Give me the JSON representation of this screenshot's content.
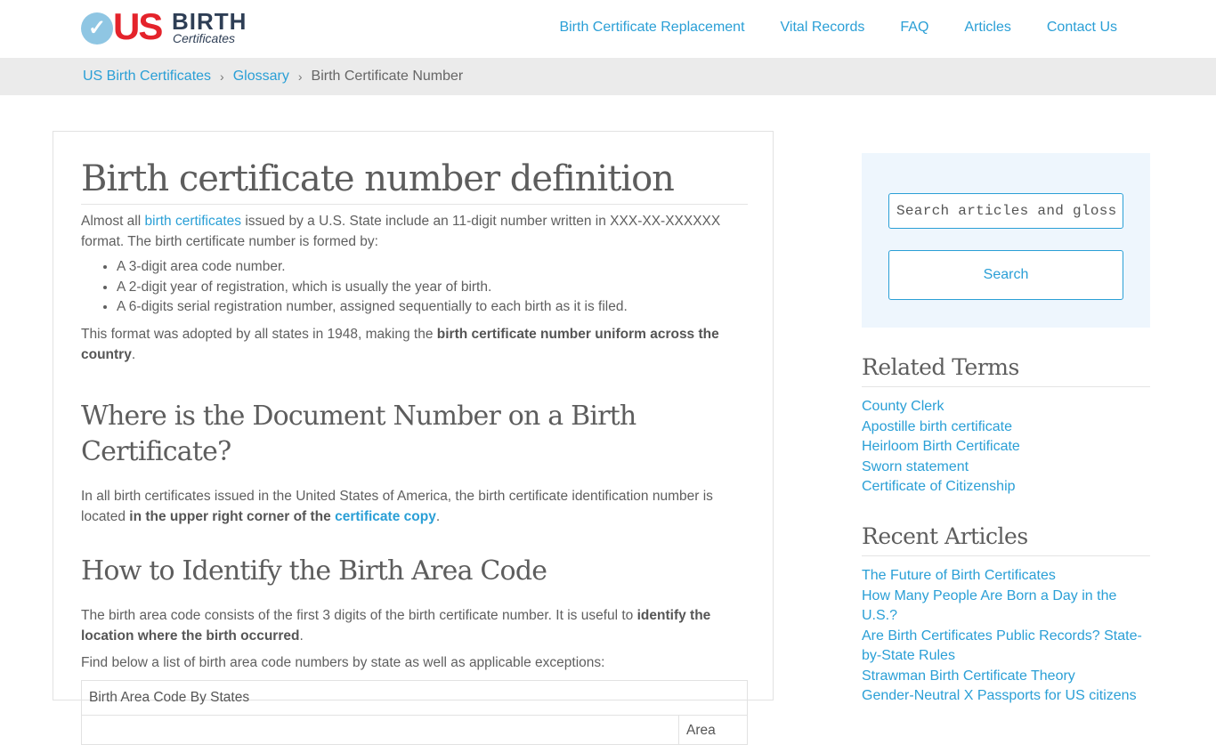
{
  "header": {
    "logo": {
      "us": "US",
      "birth": "BIRTH",
      "certificates": "Certificates"
    },
    "nav": [
      "Birth Certificate Replacement",
      "Vital Records",
      "FAQ",
      "Articles",
      "Contact Us"
    ]
  },
  "breadcrumb": {
    "items": [
      "US Birth Certificates",
      "Glossary"
    ],
    "separator": "›",
    "current": "Birth Certificate Number"
  },
  "article": {
    "title": "Birth certificate number definition",
    "intro": {
      "before": "Almost all ",
      "link": "birth certificates",
      "after": " issued by a U.S. State include an 11-digit number written in XXX-XX-XXXXXX format. The birth certificate number is formed by:"
    },
    "bullets": [
      "A 3-digit area code number.",
      "A 2-digit year of registration, which is usually the year of birth.",
      "A 6-digits serial registration number, assigned sequentially to each birth as it is filed."
    ],
    "adopted": {
      "before": "This format was adopted by all states in 1948, making the ",
      "bold": "birth certificate number uniform across the country",
      "after": "."
    },
    "h2_location": "Where is the Document Number on a Birth Certificate?",
    "location": {
      "before": "In all birth certificates issued in the United States of America, the birth certificate identification number is located ",
      "bold": "in the upper right corner of the ",
      "link": "certificate copy",
      "after": "."
    },
    "h2_area": "How to Identify the Birth Area Code",
    "area": {
      "before": "The birth area code consists of the first 3 digits of the birth certificate number. It is useful to ",
      "bold": "identify the location where the birth occurred",
      "after": "."
    },
    "find_below": "Find below a list of birth area code numbers by state as well as applicable exceptions:",
    "table": {
      "caption": "Birth Area Code By States",
      "col_area": "Area"
    }
  },
  "sidebar": {
    "search": {
      "placeholder": "Search articles and glossary",
      "button": "Search"
    },
    "related_heading": "Related Terms",
    "related": [
      "County Clerk",
      "Apostille birth certificate",
      "Heirloom Birth Certificate",
      "Sworn statement",
      "Certificate of Citizenship"
    ],
    "recent_heading": "Recent Articles",
    "recent": [
      "The Future of Birth Certificates",
      "How Many People Are Born a Day in the U.S.?",
      "Are Birth Certificates Public Records? State-by-State Rules",
      "Strawman Birth Certificate Theory",
      "Gender-Neutral X Passports for US citizens"
    ]
  },
  "colors": {
    "link": "#2a9fd6",
    "logo_red": "#e4232b",
    "logo_navy": "#2e3e55",
    "sidebar_bg": "#eef6fd"
  }
}
